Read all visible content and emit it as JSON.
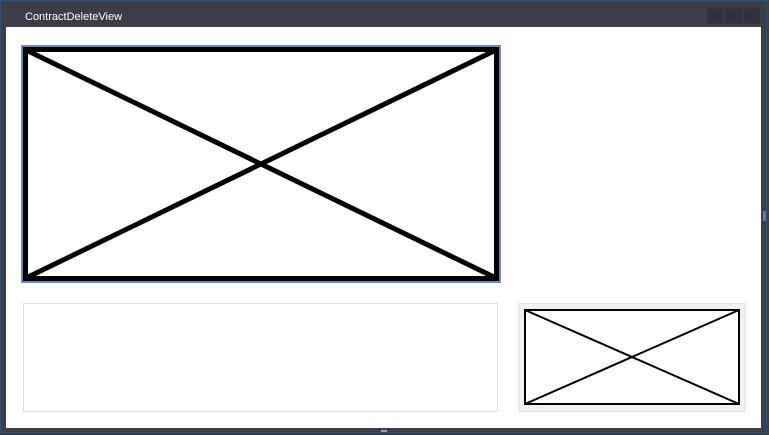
{
  "window": {
    "title": "ContractDeleteView",
    "controls": [
      "minimize-button",
      "maximize-button",
      "close-button"
    ]
  },
  "content": {
    "main_image": {
      "icon": "image-placeholder-icon"
    },
    "text_area": {
      "value": ""
    },
    "thumbnail": {
      "icon": "image-placeholder-icon"
    }
  },
  "colors": {
    "titlebar": "#3b3e47",
    "window_border": "#2b4f86",
    "selection_border": "#6f88c2",
    "content_bg": "#ffffff"
  }
}
